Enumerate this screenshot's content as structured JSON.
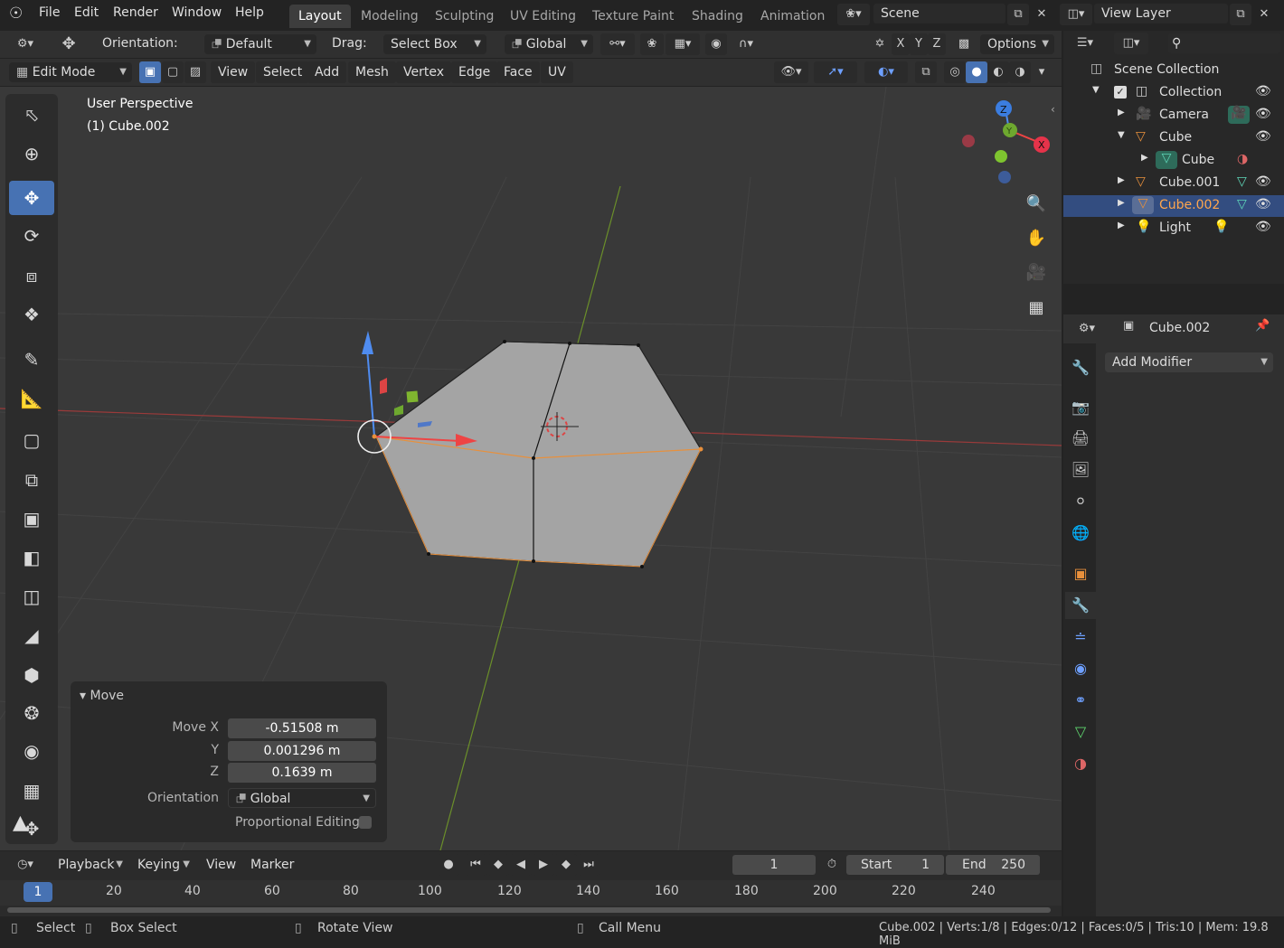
{
  "top_menu": {
    "items": [
      "File",
      "Edit",
      "Render",
      "Window",
      "Help"
    ]
  },
  "workspace_tabs": [
    {
      "label": "Layout",
      "active": true
    },
    {
      "label": "Modeling"
    },
    {
      "label": "Sculpting"
    },
    {
      "label": "UV Editing"
    },
    {
      "label": "Texture Paint"
    },
    {
      "label": "Shading"
    },
    {
      "label": "Animation"
    }
  ],
  "scene_field": "Scene",
  "view_layer_field": "View Layer",
  "header1": {
    "orientation_label": "Orientation:",
    "orientation_value": "Default",
    "drag_label": "Drag:",
    "drag_value": "Select Box",
    "transform_space": "Global",
    "options_label": "Options",
    "axis_x": "X",
    "axis_y": "Y",
    "axis_z": "Z"
  },
  "header2": {
    "mode": "Edit Mode",
    "menus": [
      "View",
      "Select",
      "Add",
      "Mesh",
      "Vertex",
      "Edge",
      "Face",
      "UV"
    ]
  },
  "viewport": {
    "perspective_label": "User Perspective",
    "object_label": "(1) Cube.002",
    "gizmo_x": "X",
    "gizmo_y": "Y",
    "gizmo_z": "Z"
  },
  "move_panel": {
    "title": "Move",
    "move_x_label": "Move X",
    "move_x": "-0.51508 m",
    "y_label": "Y",
    "y": "0.001296 m",
    "z_label": "Z",
    "z": "0.1639 m",
    "orientation_label": "Orientation",
    "orientation_value": "Global",
    "prop_edit_label": "Proportional Editing"
  },
  "outliner": {
    "root": "Scene Collection",
    "rows": [
      {
        "label": "Collection"
      },
      {
        "label": "Camera"
      },
      {
        "label": "Cube"
      },
      {
        "label": "Cube"
      },
      {
        "label": "Cube.001"
      },
      {
        "label": "Cube.002",
        "selected": true
      },
      {
        "label": "Light"
      }
    ]
  },
  "properties": {
    "object_name": "Cube.002",
    "add_modifier": "Add Modifier"
  },
  "timeline": {
    "menus": [
      "Playback",
      "Keying",
      "View",
      "Marker"
    ],
    "current_frame": "1",
    "start_label": "Start",
    "start_value": "1",
    "end_label": "End",
    "end_value": "250",
    "frame_ticks": [
      "1",
      "20",
      "40",
      "60",
      "80",
      "100",
      "120",
      "140",
      "160",
      "180",
      "200",
      "220",
      "240"
    ]
  },
  "statusbar": {
    "select": "Select",
    "box_select": "Box Select",
    "rotate_view": "Rotate View",
    "call_menu": "Call Menu",
    "stats": "Cube.002 | Verts:1/8 | Edges:0/12 | Faces:0/5 | Tris:10 | Mem: 19.8 MiB"
  },
  "colors": {
    "accent": "#4772b3",
    "selection": "#334d80",
    "orange": "#e8903c"
  }
}
